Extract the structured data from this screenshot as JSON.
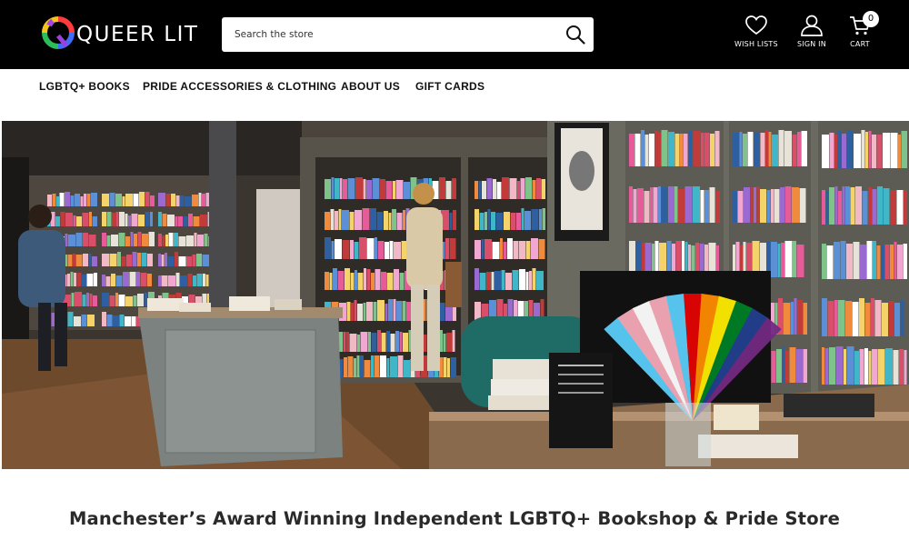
{
  "header": {
    "logo_text": "QUEER LIT",
    "search_placeholder": "Search the store",
    "wishlist_label": "WISH LISTS",
    "signin_label": "SIGN IN",
    "cart_label": "CART",
    "cart_count": "0"
  },
  "nav": {
    "items": [
      {
        "label": "LGBTQ+ BOOKS"
      },
      {
        "label": "PRIDE ACCESSORIES & CLOTHING"
      },
      {
        "label": "ABOUT US"
      },
      {
        "label": "GIFT CARDS"
      }
    ]
  },
  "hero": {
    "alt": "Interior of the Queer Lit bookshop with shelves of books, a display table and a pride flag fan on the counter"
  },
  "main": {
    "tagline": "Manchester’s Award Winning Independent LGBTQ+ Bookshop & Pride Store"
  },
  "colors": {
    "header_bg": "#000000",
    "nav_text": "#111111",
    "tagline_text": "#2a2a2a"
  }
}
